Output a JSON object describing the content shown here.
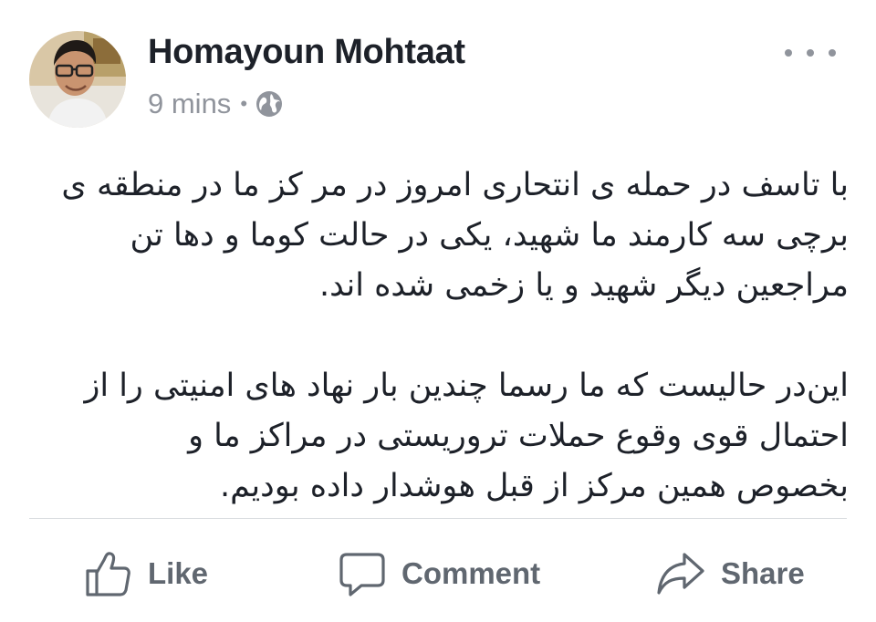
{
  "post": {
    "author": {
      "name": "Homayoun Mohtaat",
      "avatar_icon": "profile-photo"
    },
    "meta": {
      "time": "9 mins",
      "separator": "•",
      "privacy_icon": "globe-icon"
    },
    "more_icon": "ellipsis-icon",
    "text": {
      "paragraph1": [
        "با تاسف در حمله ی انتحاری امروز در مر کز ما در منطقه ی",
        "برچی سه کارمند ما شهید، یکی در حالت کوما و دها تن",
        "مراجعین دیگر شهید و یا زخمی شده اند."
      ],
      "paragraph2": [
        "این‌در حالیست که ما رسما چندین بار نهاد های امنیتی را از",
        "احتمال قوی وقوع حملات تروریستی در مراکز ما و",
        "بخصوص همین مرکز از قبل هوشدار داده بودیم."
      ]
    },
    "actions": {
      "like": {
        "label": "Like",
        "icon": "thumbs-up-icon"
      },
      "comment": {
        "label": "Comment",
        "icon": "speech-bubble-icon"
      },
      "share": {
        "label": "Share",
        "icon": "share-arrow-icon"
      }
    }
  },
  "colors": {
    "text": "#1d2129",
    "secondary": "#90949c",
    "action": "#606770",
    "divider": "#dadde1"
  }
}
